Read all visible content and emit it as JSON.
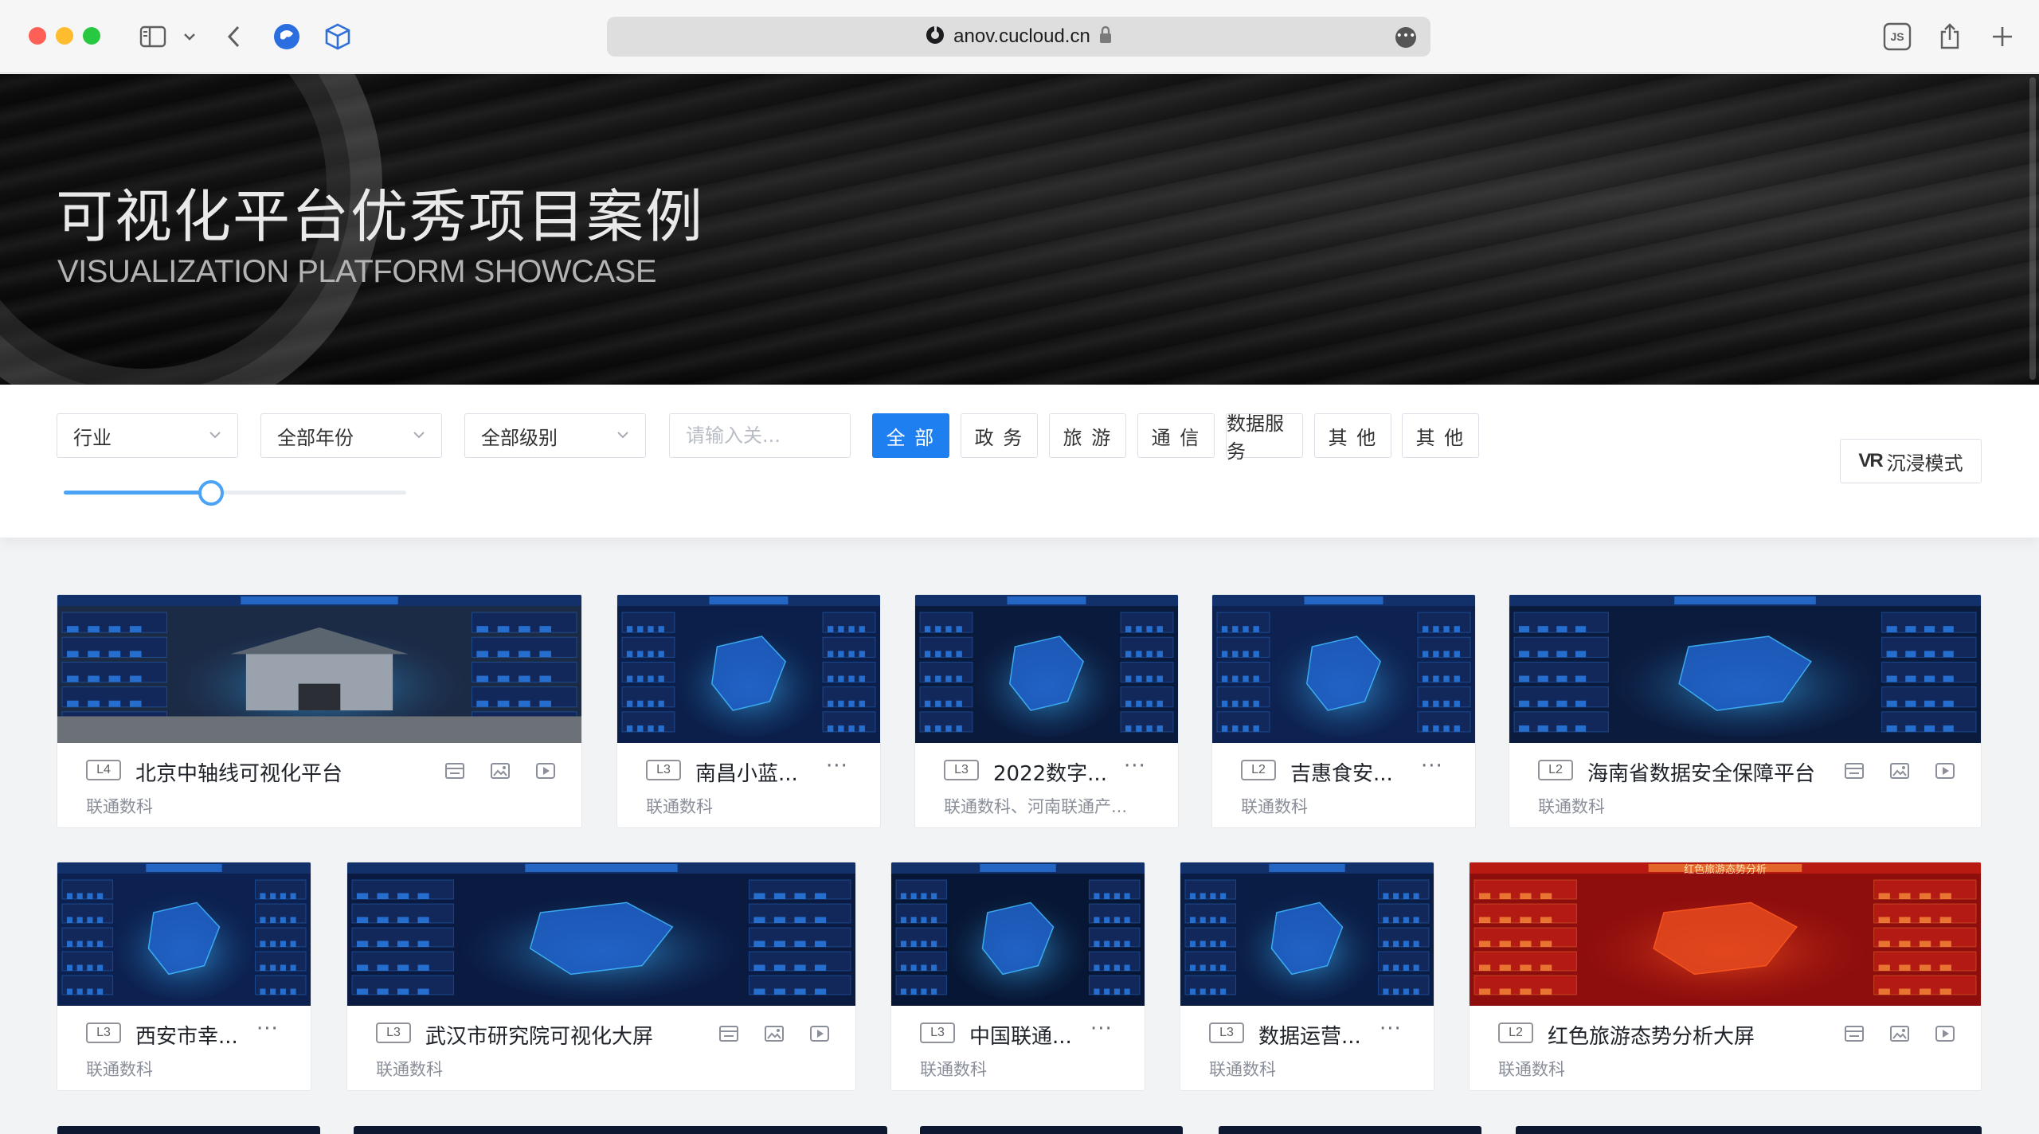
{
  "browser": {
    "url": "anov.cucloud.cn",
    "js_label": "JS"
  },
  "hero": {
    "title": "可视化平台优秀项目案例",
    "subtitle": "VISUALIZATION PLATFORM SHOWCASE"
  },
  "filters": {
    "industry": "行业",
    "year": "全部年份",
    "level": "全部级别",
    "search_placeholder": "请输入关...",
    "tags": [
      "全 部",
      "政 务",
      "旅 游",
      "通 信",
      "数据服务",
      "其 他",
      "其 他"
    ],
    "active_tag": 0,
    "slider_value": 0.43,
    "vr_label": "沉浸模式"
  },
  "cards": [
    {
      "level": "L4",
      "title": "北京中轴线可视化平台",
      "org": "联通数科",
      "theme": "#1b2a45"
    },
    {
      "level": "L3",
      "title": "南昌小蓝...",
      "org": "联通数科",
      "theme": "#0b1f4a"
    },
    {
      "level": "L3",
      "title": "2022数字...",
      "org": "联通数科、河南联通产...",
      "theme": "#0a1a3d"
    },
    {
      "level": "L2",
      "title": "吉惠食安...",
      "org": "联通数科",
      "theme": "#0d2250"
    },
    {
      "level": "L2",
      "title": "海南省数据安全保障平台",
      "org": "联通数科",
      "theme": "#0b1b3e"
    },
    {
      "level": "L3",
      "title": "西安市幸...",
      "org": "联通数科",
      "theme": "#0c2150"
    },
    {
      "level": "L3",
      "title": "武汉市研究院可视化大屏",
      "org": "联通数科",
      "theme": "#0a1a40"
    },
    {
      "level": "L3",
      "title": "中国联通...",
      "org": "联通数科",
      "theme": "#071634"
    },
    {
      "level": "L3",
      "title": "数据运营...",
      "org": "联通数科",
      "theme": "#0a1d45"
    },
    {
      "level": "L2",
      "title": "红色旅游态势分析大屏",
      "org": "联通数科",
      "theme": "#8e0d0d",
      "header": "红色旅游态势分析"
    }
  ]
}
